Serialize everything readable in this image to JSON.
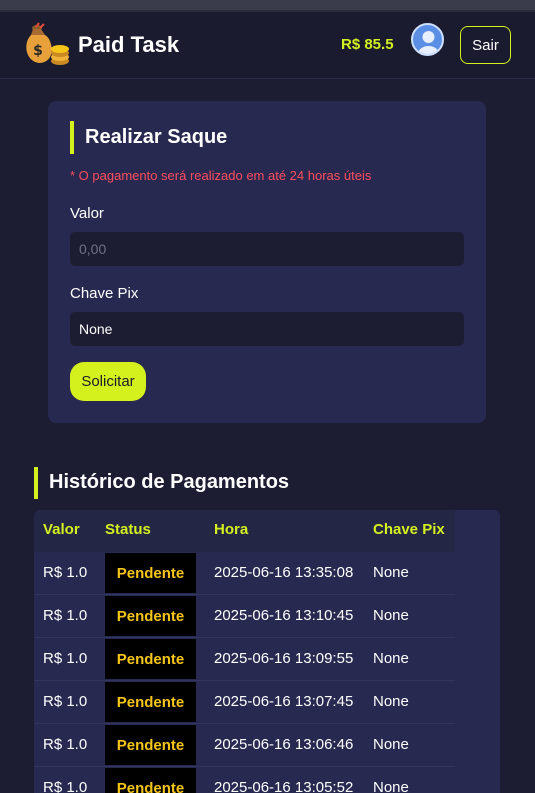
{
  "header": {
    "brand": "Paid Task",
    "balance": "R$ 85.5",
    "exit_label": "Sair"
  },
  "form": {
    "title": "Realizar Saque",
    "notice": "* O pagamento será realizado em até 24 horas úteis",
    "amount_label": "Valor",
    "amount_placeholder": "0,00",
    "pix_label": "Chave Pix",
    "pix_value": "None",
    "submit_label": "Solicitar"
  },
  "history": {
    "title": "Histórico de Pagamentos",
    "columns": [
      "Valor",
      "Status",
      "Hora",
      "Chave Pix"
    ],
    "rows": [
      {
        "amount": "R$ 1.0",
        "status": "Pendente",
        "time": "2025-06-16 13:35:08",
        "pix": "None"
      },
      {
        "amount": "R$ 1.0",
        "status": "Pendente",
        "time": "2025-06-16 13:10:45",
        "pix": "None"
      },
      {
        "amount": "R$ 1.0",
        "status": "Pendente",
        "time": "2025-06-16 13:09:55",
        "pix": "None"
      },
      {
        "amount": "R$ 1.0",
        "status": "Pendente",
        "time": "2025-06-16 13:07:45",
        "pix": "None"
      },
      {
        "amount": "R$ 1.0",
        "status": "Pendente",
        "time": "2025-06-16 13:06:46",
        "pix": "None"
      },
      {
        "amount": "R$ 1.0",
        "status": "Pendente",
        "time": "2025-06-16 13:05:52",
        "pix": "None"
      }
    ]
  },
  "icons": {
    "logo": "money-bag-icon",
    "avatar": "user-avatar-icon"
  },
  "colors": {
    "accent": "#d4f01d",
    "background": "#1c1d33",
    "card": "#272950",
    "notice": "#ff4d5e",
    "pending": "#f5c518"
  }
}
